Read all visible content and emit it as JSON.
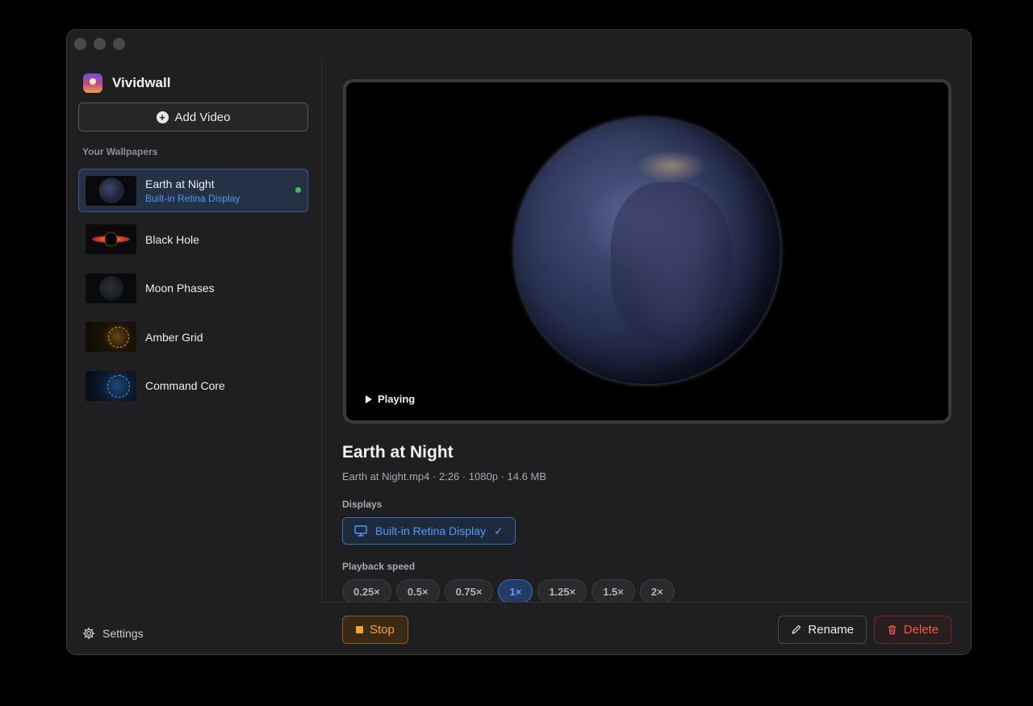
{
  "app": {
    "name": "Vividwall"
  },
  "sidebar": {
    "add_label": "Add Video",
    "section_label": "Your Wallpapers",
    "items": [
      {
        "title": "Earth at Night",
        "subtitle": "Built-in Retina Display",
        "selected": true,
        "active": true,
        "thumb": "earth"
      },
      {
        "title": "Black Hole",
        "subtitle": "",
        "thumb": "black-hole"
      },
      {
        "title": "Moon Phases",
        "subtitle": "",
        "thumb": "moon"
      },
      {
        "title": "Amber Grid",
        "subtitle": "",
        "thumb": "amber-grid"
      },
      {
        "title": "Command Core",
        "subtitle": "",
        "thumb": "command-core"
      }
    ],
    "settings_label": "Settings"
  },
  "preview": {
    "status": "Playing"
  },
  "detail": {
    "title": "Earth at Night",
    "meta": "Earth at Night.mp4 · 2:26 · 1080p · 14.6 MB",
    "displays_label": "Displays",
    "display_chip": "Built-in Retina Display",
    "display_check": "✓",
    "speed_label": "Playback speed",
    "speeds": [
      "0.25×",
      "0.5×",
      "0.75×",
      "1×",
      "1.25×",
      "1.5×",
      "2×"
    ],
    "selected_speed": "1×"
  },
  "footer": {
    "stop_label": "Stop",
    "rename_label": "Rename",
    "delete_label": "Delete"
  },
  "colors": {
    "accent": "#4f9cf9",
    "stop": "#f2a33a",
    "delete": "#ef5a4f",
    "active_dot": "#3fbf5a"
  }
}
